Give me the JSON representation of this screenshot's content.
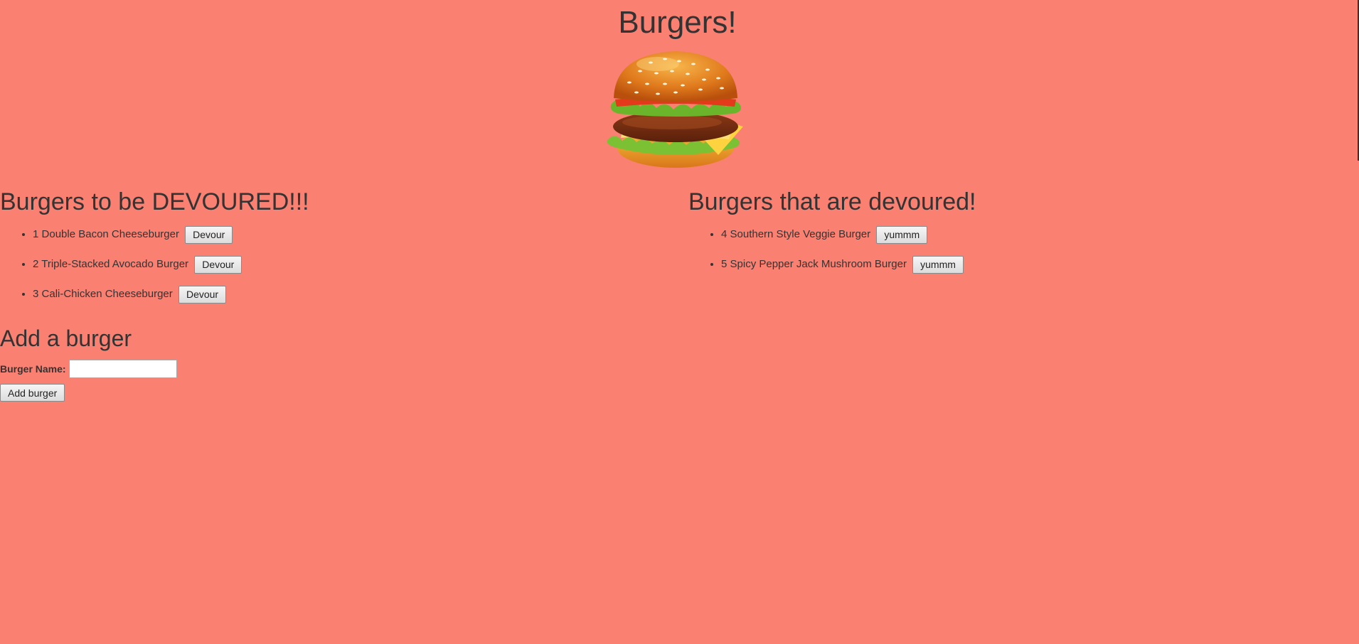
{
  "page": {
    "title": "Burgers!"
  },
  "hero": {
    "image": "burger-illustration"
  },
  "uneaten": {
    "heading": "Burgers to be DEVOURED!!!",
    "button_label": "Devour",
    "items": [
      {
        "id": "1",
        "name": "Double Bacon Cheeseburger"
      },
      {
        "id": "2",
        "name": "Triple-Stacked Avocado Burger"
      },
      {
        "id": "3",
        "name": "Cali-Chicken Cheeseburger"
      }
    ]
  },
  "eaten": {
    "heading": "Burgers that are devoured!",
    "button_label": "yummm",
    "items": [
      {
        "id": "4",
        "name": "Southern Style Veggie Burger"
      },
      {
        "id": "5",
        "name": "Spicy Pepper Jack Mushroom Burger"
      }
    ]
  },
  "add_form": {
    "heading": "Add a burger",
    "name_label": "Burger Name:",
    "name_value": "",
    "submit_label": "Add burger"
  },
  "colors": {
    "background": "#fa8072",
    "text": "#333333"
  }
}
